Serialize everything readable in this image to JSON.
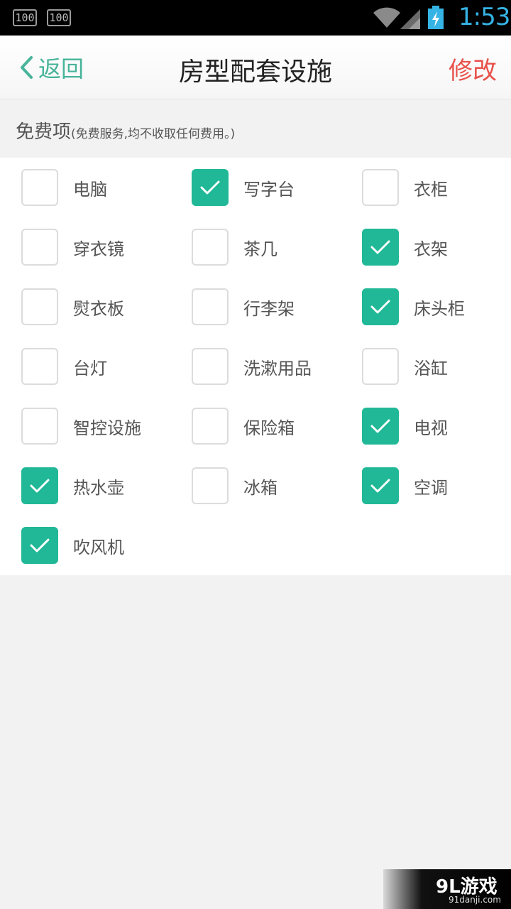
{
  "status_bar": {
    "badge_1": "100",
    "badge_2": "100",
    "time": "1:53",
    "time_color": "#35b3e5"
  },
  "header": {
    "back_label": "返回",
    "title": "房型配套设施",
    "edit_label": "修改",
    "accent_color": "#48b49a",
    "edit_color": "#e8514a"
  },
  "section": {
    "title": "免费项",
    "subtitle": "(免费服务,均不收取任何费用。)"
  },
  "check_color": "#20b896",
  "items": [
    {
      "label": "电脑",
      "checked": false
    },
    {
      "label": "写字台",
      "checked": true
    },
    {
      "label": "衣柜",
      "checked": false
    },
    {
      "label": "穿衣镜",
      "checked": false
    },
    {
      "label": "茶几",
      "checked": false
    },
    {
      "label": "衣架",
      "checked": true
    },
    {
      "label": "熨衣板",
      "checked": false
    },
    {
      "label": "行李架",
      "checked": false
    },
    {
      "label": "床头柜",
      "checked": true
    },
    {
      "label": "台灯",
      "checked": false
    },
    {
      "label": "洗漱用品",
      "checked": false
    },
    {
      "label": "浴缸",
      "checked": false
    },
    {
      "label": "智控设施",
      "checked": false
    },
    {
      "label": "保险箱",
      "checked": false
    },
    {
      "label": "电视",
      "checked": true
    },
    {
      "label": "热水壶",
      "checked": true
    },
    {
      "label": "冰箱",
      "checked": false
    },
    {
      "label": "空调",
      "checked": true
    },
    {
      "label": "吹风机",
      "checked": true
    }
  ],
  "watermark": {
    "main": "9L游戏",
    "sub": "91danji.com"
  }
}
